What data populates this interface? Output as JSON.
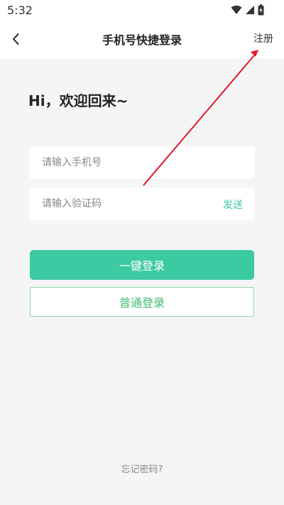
{
  "status_bar": {
    "time": "5:32",
    "icons": [
      "wifi-icon",
      "signal-icon",
      "battery-icon"
    ]
  },
  "nav": {
    "back_icon": "chevron-left-icon",
    "title": "手机号快捷登录",
    "register_label": "注册"
  },
  "greeting": "Hi，欢迎回来~",
  "phone_input": {
    "placeholder": "请输入手机号",
    "value": ""
  },
  "code_input": {
    "placeholder": "请输入验证码",
    "value": "",
    "send_label": "发送"
  },
  "quick_login_label": "一键登录",
  "normal_login_label": "普通登录",
  "forgot_password_label": "忘记密码?",
  "colors": {
    "accent": "#3ccaa3",
    "outline_text": "#3cbf6c",
    "annotation": "#e0182b"
  }
}
